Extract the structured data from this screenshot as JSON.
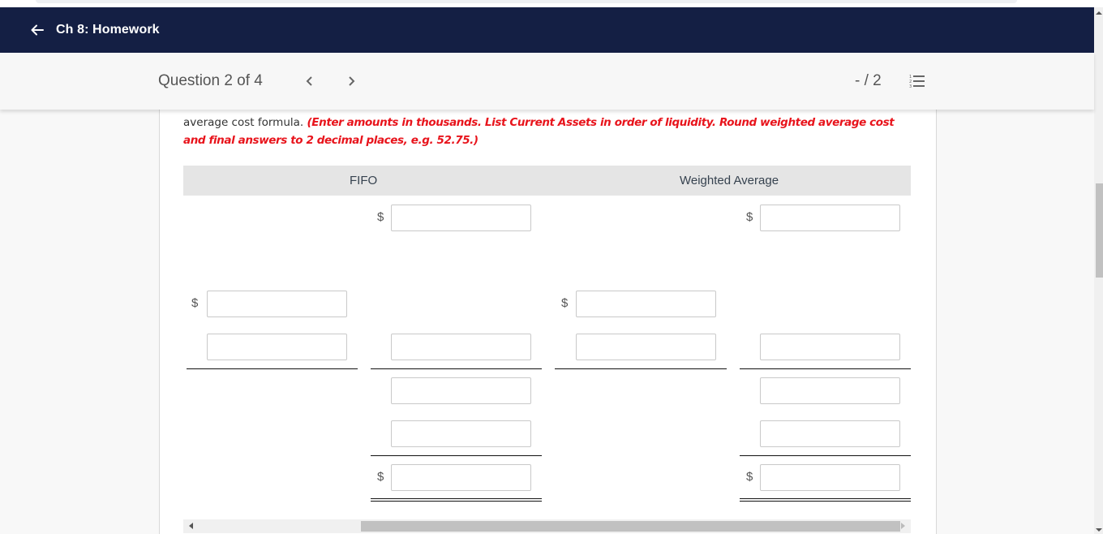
{
  "header": {
    "title": "Ch 8: Homework",
    "back_icon": "arrow-left-icon",
    "background": "#141f44"
  },
  "question_bar": {
    "label": "Question 2 of 4",
    "prev_icon": "chevron-left-icon",
    "next_icon": "chevron-right-icon",
    "score": "- / 2",
    "list_icon": "numbered-list-icon"
  },
  "instructions": {
    "text": "average cost formula.",
    "note": "(Enter amounts in thousands. List Current Assets in order of liquidity. Round weighted average cost and final answers to 2 decimal places, e.g. 52.75.)",
    "note_color": "#e8141c"
  },
  "table": {
    "columns": [
      "FIFO",
      "Weighted Average"
    ],
    "currency_symbol": "$",
    "inputs": {
      "fifo_cogs": "",
      "wa_cogs": "",
      "fifo_sub_1": "",
      "fifo_total_row2": "",
      "wa_sub_1": "",
      "fifo_sub_2": "",
      "fifo_col2_row3": "",
      "wa_sub_2": "",
      "wa_col2_row3": "",
      "fifo_col2_row4": "",
      "wa_col2_row4": "",
      "fifo_col2_row5": "",
      "wa_col2_row5": "",
      "fifo_total": "",
      "wa_total": ""
    }
  }
}
